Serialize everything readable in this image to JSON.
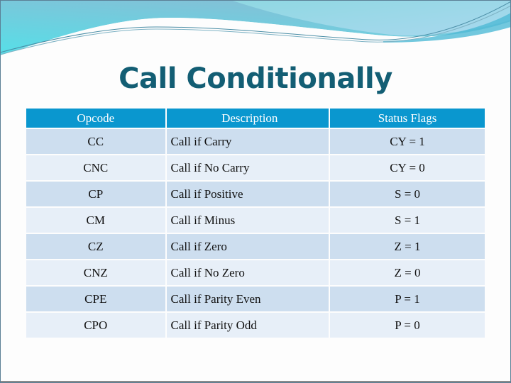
{
  "slide": {
    "title": "Call Conditionally",
    "colors": {
      "title": "#135e74",
      "header_bg": "#0a97cf",
      "row_odd": "#cddeef",
      "row_even": "#e7eff8"
    }
  },
  "table": {
    "headers": [
      "Opcode",
      "Description",
      "Status Flags"
    ],
    "rows": [
      {
        "opcode": "CC",
        "description": "Call if Carry",
        "flags": "CY = 1"
      },
      {
        "opcode": "CNC",
        "description": "Call if No Carry",
        "flags": "CY = 0"
      },
      {
        "opcode": "CP",
        "description": "Call if Positive",
        "flags": "S = 0"
      },
      {
        "opcode": "CM",
        "description": "Call if Minus",
        "flags": "S = 1"
      },
      {
        "opcode": "CZ",
        "description": "Call if Zero",
        "flags": "Z = 1"
      },
      {
        "opcode": "CNZ",
        "description": "Call if No Zero",
        "flags": "Z = 0"
      },
      {
        "opcode": "CPE",
        "description": "Call if Parity Even",
        "flags": "P = 1"
      },
      {
        "opcode": "CPO",
        "description": "Call if Parity Odd",
        "flags": "P = 0"
      }
    ]
  }
}
